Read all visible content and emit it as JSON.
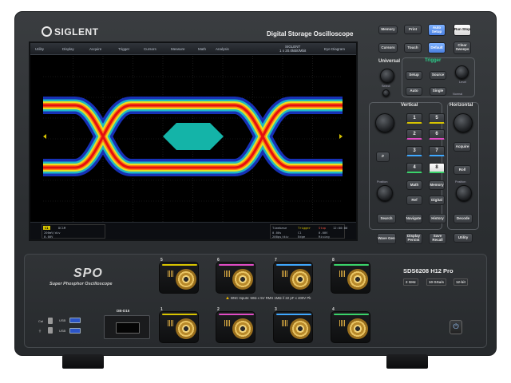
{
  "brand": {
    "logo": "SIGLENT",
    "title": "Digital Storage Oscilloscope"
  },
  "screen": {
    "menu": [
      "Utility",
      "Display",
      "Acquire",
      "Trigger",
      "Cursors",
      "Measure",
      "Math",
      "Analysis"
    ],
    "scope_brand": "SIGLENT",
    "sample_info": "1 x 20.0kBit/Mbit",
    "mode": "Eye Diagram",
    "ch1": {
      "tag": "C1",
      "line2": "DC1M",
      "line3": "200mV/div",
      "line4": "0.00V"
    },
    "timebase": {
      "label": "Timebase",
      "delay": "0.00s",
      "scale": "200ps/div",
      "trig_label": "Trigger",
      "trig_src": "C1",
      "trig_level": "0.00V",
      "trig_mode": "Edge",
      "trig_slope": "Rising",
      "date": "12:00:00",
      "run": "Stop"
    }
  },
  "buttons": {
    "memory": "Memory",
    "print": "Print",
    "auto_setup": "Auto Setup",
    "run_stop": "Run Stop",
    "cursors": "Cursors",
    "touch": "Touch",
    "default": "Default",
    "clear_sweeps": "Clear Sweeps",
    "setup": "Setup",
    "source": "Source",
    "auto": "Auto",
    "single": "Single",
    "normal": "Normal",
    "math": "Math",
    "ref": "Ref",
    "digital": "Digital",
    "roll": "Roll",
    "zoom": "Zoom",
    "acquire": "Acquire",
    "search": "Search",
    "navigate": "Navigate",
    "history": "History",
    "decode": "Decode",
    "wavegen": "Wave Gen",
    "display_persist": "Display Persist",
    "save_recall": "Save Recall",
    "utility": "Utility"
  },
  "groups": {
    "universal": "Universal",
    "trigger": "Trigger",
    "vertical": "Vertical",
    "horizontal": "Horizontal",
    "position": "Position",
    "select": "Select",
    "level": "Level"
  },
  "channels": [
    "1",
    "2",
    "3",
    "4",
    "5",
    "6",
    "7",
    "8"
  ],
  "channel_colors": [
    "#d8c400",
    "#e04cc4",
    "#3fa8ff",
    "#3ad36a",
    "#d8c400",
    "#e04cc4",
    "#3fa8ff",
    "#3ad36a"
  ],
  "front": {
    "spo": "SPO",
    "spo_sub": "Super Phosphor Oscilloscope",
    "model": "SDS6208 H12 Pro",
    "specs": [
      "2 GHz",
      "10 GSa/s",
      "12-bit"
    ],
    "warning": "BNC Inputs: 50Ω ≤ 5V RMS   1MΩ // 22 pF ≤ 400V Pk",
    "dedb": "DB-D15",
    "usb_labels": [
      "USB",
      "USB"
    ],
    "cal": "Cal"
  }
}
